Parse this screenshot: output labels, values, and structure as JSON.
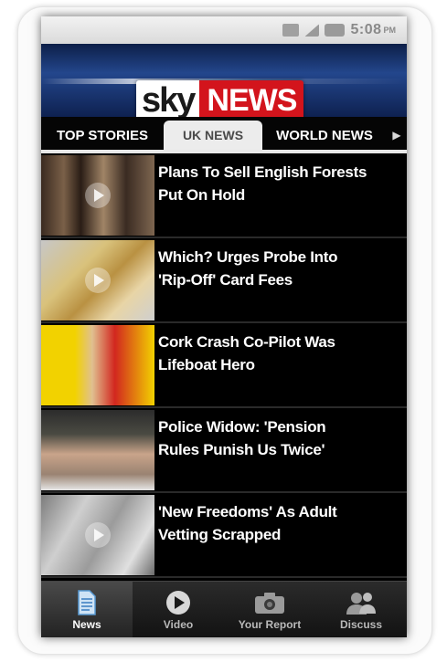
{
  "status_bar": {
    "time": "5:08",
    "ampm": "PM",
    "icons": [
      "sync-icon",
      "signal-icon",
      "battery-icon"
    ]
  },
  "header": {
    "logo_sky": "sky",
    "logo_news": "NEWS",
    "colors": {
      "brand_red": "#d3141c",
      "header_blue": "#23468c"
    }
  },
  "tabs": [
    {
      "label": "TOP STORIES",
      "active": false
    },
    {
      "label": "UK NEWS",
      "active": true
    },
    {
      "label": "WORLD NEWS",
      "active": false
    }
  ],
  "articles": [
    {
      "headline_line1": "Plans To Sell English Forests",
      "headline_line2": "Put On Hold",
      "has_video": true
    },
    {
      "headline_line1": "Which? Urges Probe Into",
      "headline_line2": "'Rip-Off' Card Fees",
      "has_video": true
    },
    {
      "headline_line1": "Cork Crash Co-Pilot Was",
      "headline_line2": "Lifeboat Hero",
      "has_video": false
    },
    {
      "headline_line1": "Police Widow: 'Pension",
      "headline_line2": "Rules Punish Us Twice'",
      "has_video": false
    },
    {
      "headline_line1": "'New Freedoms' As Adult",
      "headline_line2": "Vetting Scrapped",
      "has_video": true
    }
  ],
  "bottom_nav": [
    {
      "label": "News",
      "icon": "document-icon",
      "active": true
    },
    {
      "label": "Video",
      "icon": "play-icon",
      "active": false
    },
    {
      "label": "Your Report",
      "icon": "camera-icon",
      "active": false
    },
    {
      "label": "Discuss",
      "icon": "people-icon",
      "active": false
    }
  ]
}
